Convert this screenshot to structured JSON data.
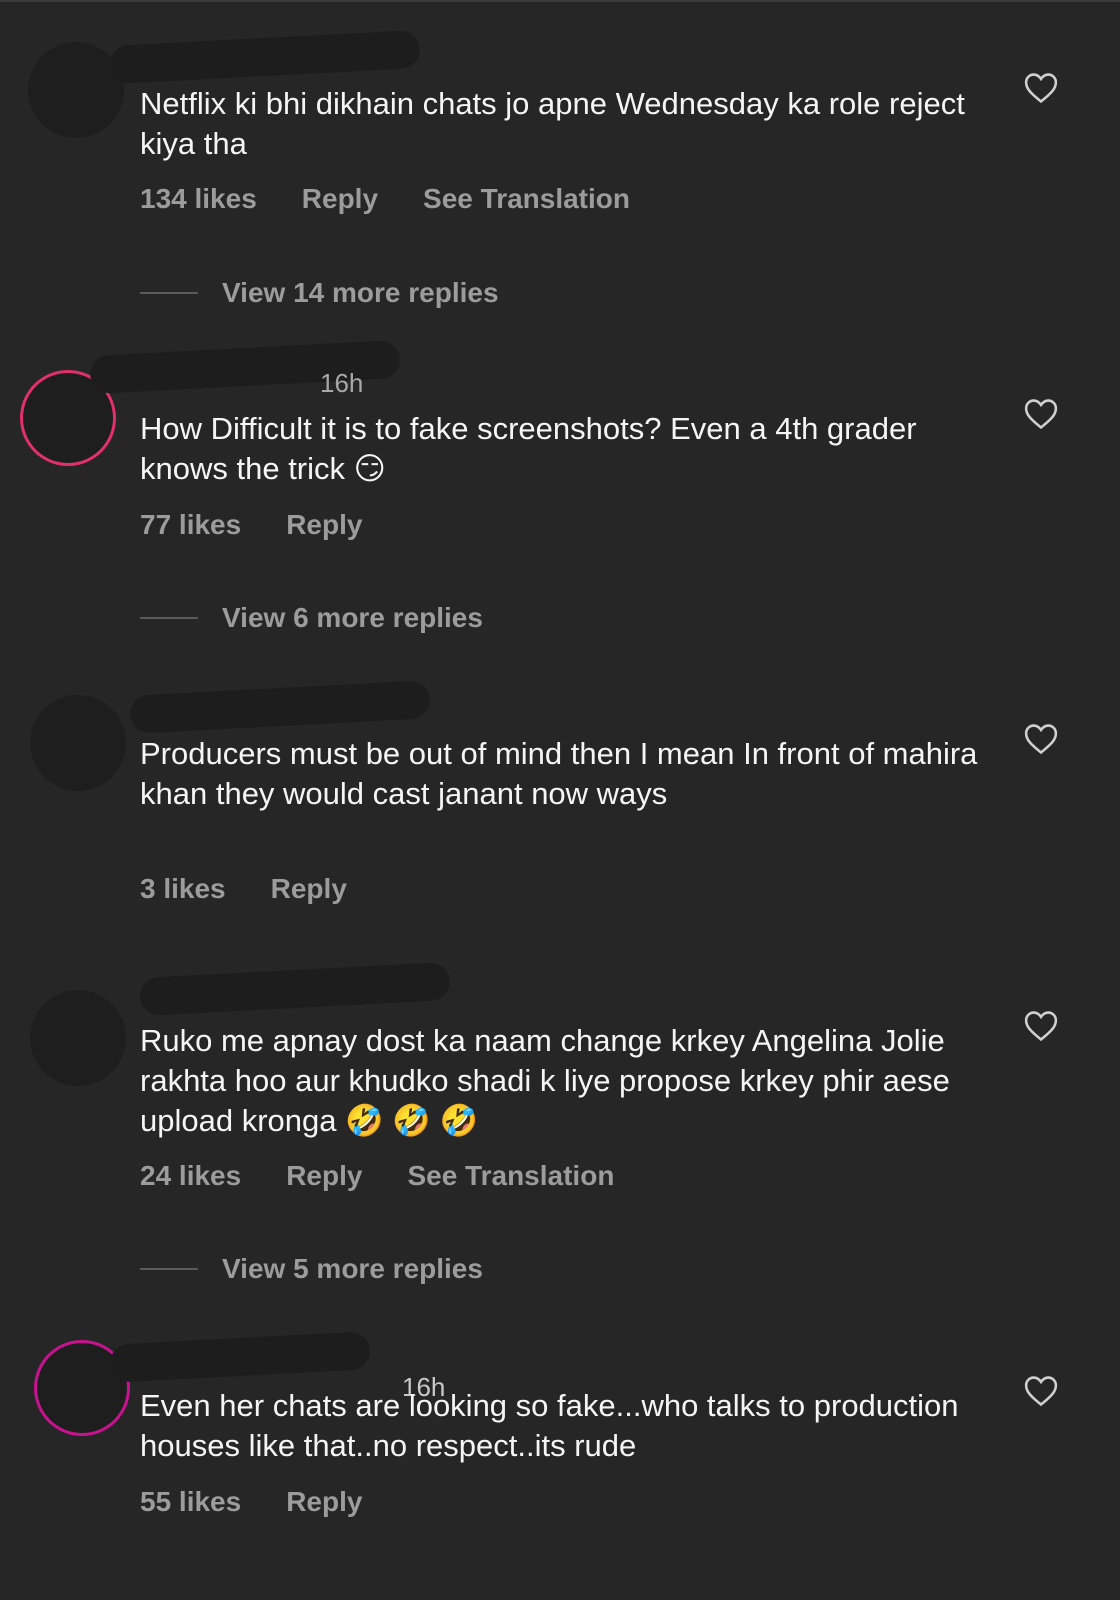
{
  "comments": [
    {
      "username": "",
      "time": "",
      "text": "Netflix ki bhi dikhain chats jo apne Wednesday ka role reject kiya tha",
      "likes": "134 likes",
      "reply": "Reply",
      "translate": "See Translation",
      "view_more": "View 14 more replies"
    },
    {
      "username": "",
      "time": "16h",
      "text": "How Difficult it is to fake screenshots? Even a 4th grader knows the trick 😏",
      "likes": "77 likes",
      "reply": "Reply",
      "view_more": "View 6 more replies"
    },
    {
      "username": "",
      "time": "",
      "text": "Producers must be out of mind then I mean In front of mahira khan they would cast janant now ways",
      "likes": "3 likes",
      "reply": "Reply"
    },
    {
      "username": "",
      "time": "",
      "text": "Ruko me apnay dost ka naam change krkey Angelina Jolie rakhta hoo aur khudko shadi k liye propose krkey phir aese upload kronga 🤣 🤣 🤣",
      "likes": "24 likes",
      "reply": "Reply",
      "translate": "See Translation",
      "view_more": "View 5 more replies"
    },
    {
      "username": "",
      "time": "16h",
      "text": "Even her chats are looking so fake...who talks to production houses like that..no respect..its rude",
      "likes": "55 likes",
      "reply": "Reply"
    }
  ],
  "icons": {
    "like": "heart-outline-icon"
  },
  "colors": {
    "background": "#262626",
    "text": "#f5f5f5",
    "secondary": "#9c9c9c"
  }
}
